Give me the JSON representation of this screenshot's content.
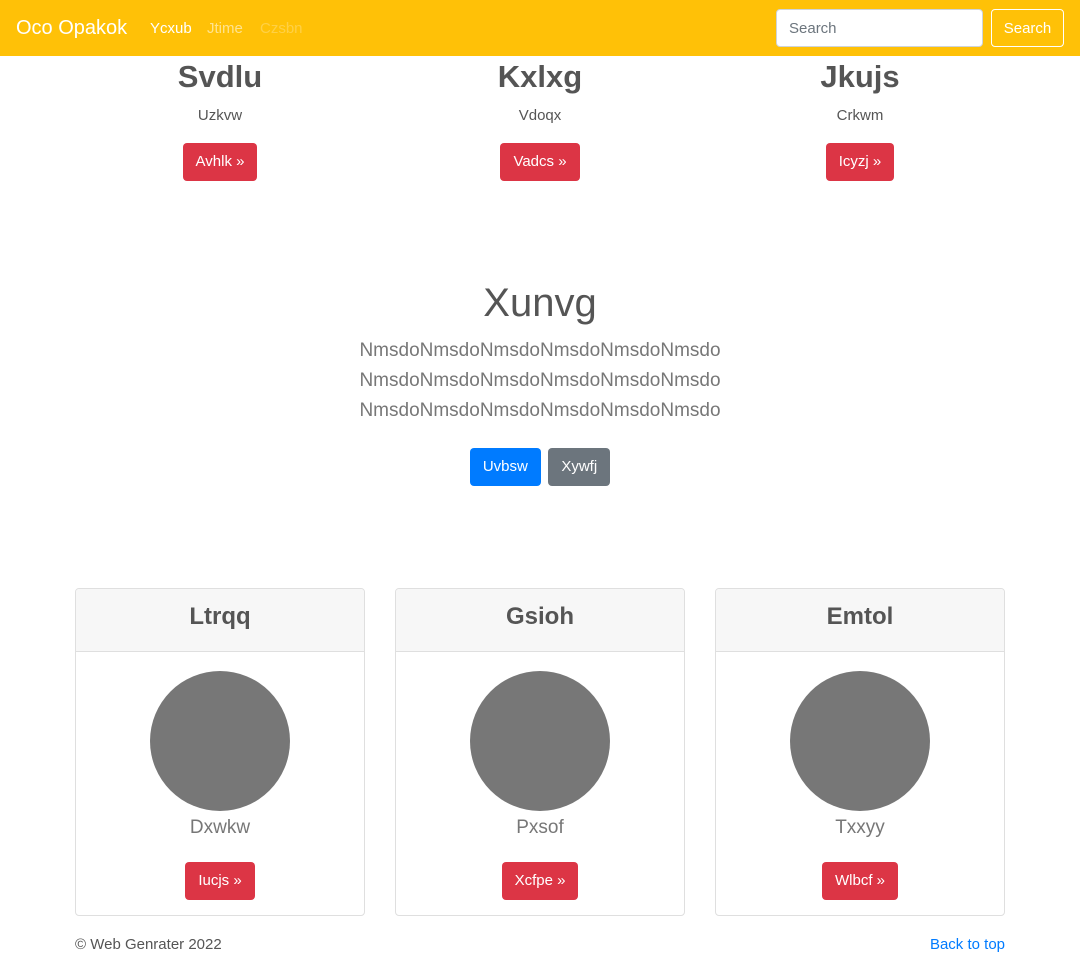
{
  "navbar": {
    "brand": "Oco Opakok",
    "links": [
      "Ycxub",
      "Jtime",
      "Czsbn"
    ],
    "search_placeholder": "Search",
    "search_button": "Search"
  },
  "features": [
    {
      "title": "Svdlu",
      "text": "Uzkvw",
      "button": "Avhlk »"
    },
    {
      "title": "Kxlxg",
      "text": "Vdoqx",
      "button": "Vadcs »"
    },
    {
      "title": "Jkujs",
      "text": "Crkwm",
      "button": "Icyzj »"
    }
  ],
  "hero": {
    "title": "Xunvg",
    "lead": "NmsdoNmsdoNmsdoNmsdoNmsdoNmsdoNmsdoNmsdoNmsdoNmsdoNmsdoNmsdoNmsdoNmsdoNmsdoNmsdoNmsdoNmsdo",
    "primary_button": "Uvbsw",
    "secondary_button": "Xywfj"
  },
  "cards": [
    {
      "header": "Ltrqq",
      "name": "Dxwkw",
      "button": "Iucjs »"
    },
    {
      "header": "Gsioh",
      "name": "Pxsof",
      "button": "Xcfpe »"
    },
    {
      "header": "Emtol",
      "name": "Txxyy",
      "button": "Wlbcf »"
    }
  ],
  "footer": {
    "copyright": "© Web Genrater 2022",
    "back_to_top": "Back to top"
  },
  "colors": {
    "navbar": "#ffc107",
    "danger": "#dc3545",
    "primary": "#007bff",
    "secondary": "#6c757d",
    "avatar": "#777777"
  }
}
